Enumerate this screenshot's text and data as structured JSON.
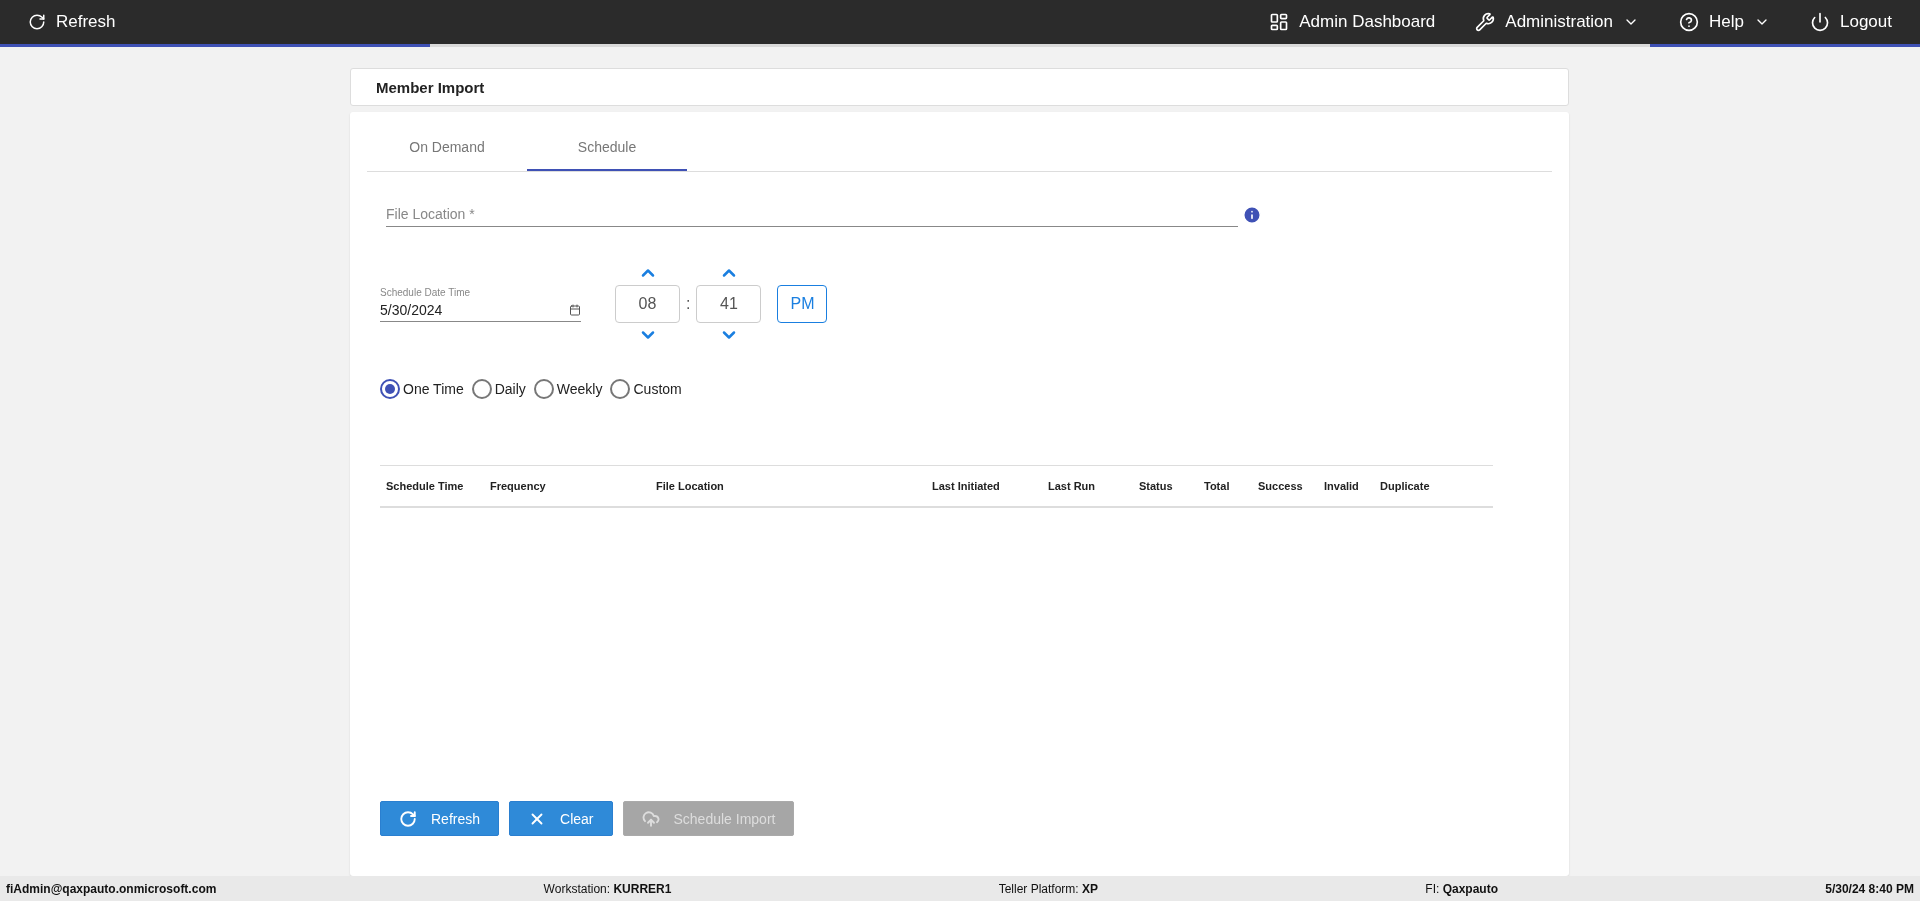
{
  "nav": {
    "refresh": "Refresh",
    "items": [
      {
        "label": "Admin Dashboard",
        "kind": "link"
      },
      {
        "label": "Administration",
        "kind": "menu"
      },
      {
        "label": "Help",
        "kind": "menu"
      },
      {
        "label": "Logout",
        "kind": "link"
      }
    ]
  },
  "page_title": "Member Import",
  "tabs": [
    {
      "label": "On Demand",
      "selected": false
    },
    {
      "label": "Schedule",
      "selected": true
    }
  ],
  "file_location": {
    "placeholder": "File Location *"
  },
  "schedule": {
    "label": "Schedule Date Time",
    "value": "5/30/2024",
    "hour": "08",
    "separator": ":",
    "minute": "41",
    "period": "PM"
  },
  "frequency": [
    {
      "label": "One Time",
      "selected": true
    },
    {
      "label": "Daily",
      "selected": false
    },
    {
      "label": "Weekly",
      "selected": false
    },
    {
      "label": "Custom",
      "selected": false
    }
  ],
  "table": {
    "columns": [
      "Schedule Time",
      "Frequency",
      "File Location",
      "Last Initiated",
      "Last Run",
      "Status",
      "Total",
      "Success",
      "Invalid",
      "Duplicate"
    ]
  },
  "buttons": [
    {
      "label": "Refresh",
      "kind": "refresh",
      "disabled": false
    },
    {
      "label": "Clear",
      "kind": "clear",
      "disabled": false
    },
    {
      "label": "Schedule Import",
      "kind": "upload",
      "disabled": true
    }
  ],
  "status_bar": {
    "user": "fiAdmin@qaxpauto.onmicrosoft.com",
    "fields": [
      {
        "label": "Workstation:",
        "value": "KURRER1"
      },
      {
        "label": "Teller Platform:",
        "value": "XP"
      },
      {
        "label": "FI:",
        "value": "Qaxpauto"
      }
    ],
    "datetime": "5/30/24 8:40 PM"
  }
}
